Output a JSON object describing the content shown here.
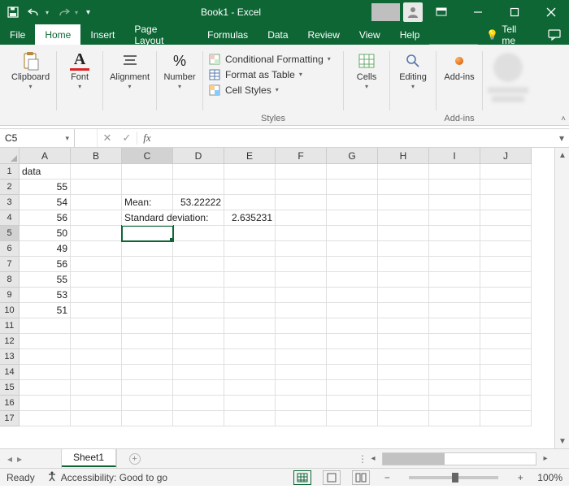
{
  "titlebar": {
    "title": "Book1 - Excel"
  },
  "menu": {
    "file": "File",
    "home": "Home",
    "insert": "Insert",
    "page_layout": "Page Layout",
    "formulas": "Formulas",
    "data": "Data",
    "review": "Review",
    "view": "View",
    "help": "Help",
    "tell_me": "Tell me"
  },
  "ribbon": {
    "clipboard": "Clipboard",
    "font": "Font",
    "alignment": "Alignment",
    "number": "Number",
    "cond_fmt": "Conditional Formatting",
    "as_table": "Format as Table",
    "cell_styles": "Cell Styles",
    "styles": "Styles",
    "cells": "Cells",
    "editing": "Editing",
    "addins": "Add-ins"
  },
  "name_box": "C5",
  "columns": [
    "A",
    "B",
    "C",
    "D",
    "E",
    "F",
    "G",
    "H",
    "I",
    "J"
  ],
  "rows": [
    "1",
    "2",
    "3",
    "4",
    "5",
    "6",
    "7",
    "8",
    "9",
    "10",
    "11",
    "12",
    "13",
    "14",
    "15",
    "16",
    "17"
  ],
  "cells": {
    "A1": "data",
    "A2": "55",
    "A3": "54",
    "A4": "56",
    "A5": "50",
    "A6": "49",
    "A7": "56",
    "A8": "55",
    "A9": "53",
    "A10": "51",
    "C3": "Mean:",
    "D3": "53.22222",
    "C4": "Standard deviation:",
    "E4": "2.635231"
  },
  "sheet": {
    "name": "Sheet1"
  },
  "status": {
    "ready": "Ready",
    "accessibility": "Accessibility: Good to go",
    "zoom": "100%"
  },
  "chart_data": {
    "type": "table",
    "title": "data",
    "values": [
      55,
      54,
      56,
      50,
      49,
      56,
      55,
      53,
      51
    ],
    "summary": {
      "mean": 53.22222,
      "standard_deviation": 2.635231
    }
  }
}
